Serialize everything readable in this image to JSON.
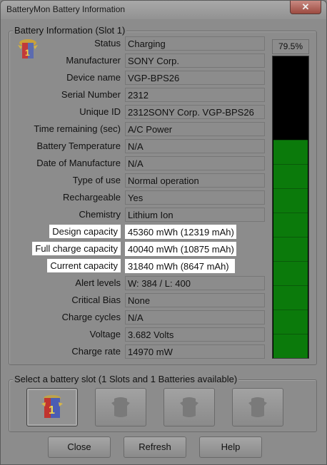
{
  "window": {
    "title": "BatteryMon Battery Information",
    "close_glyph": "✕"
  },
  "info_group": {
    "legend": "Battery Information (Slot 1)"
  },
  "fields": [
    {
      "label": "Status",
      "value": "Charging"
    },
    {
      "label": "Manufacturer",
      "value": "SONY Corp."
    },
    {
      "label": "Device name",
      "value": "VGP-BPS26"
    },
    {
      "label": "Serial Number",
      "value": "2312"
    },
    {
      "label": "Unique ID",
      "value": "2312SONY Corp. VGP-BPS26"
    },
    {
      "label": "Time remaining (sec)",
      "value": "A/C Power"
    },
    {
      "label": "Battery Temperature",
      "value": "N/A"
    },
    {
      "label": "Date of Manufacture",
      "value": "N/A"
    },
    {
      "label": "Type of use",
      "value": "Normal operation"
    },
    {
      "label": "Rechargeable",
      "value": "Yes"
    },
    {
      "label": "Chemistry",
      "value": "Lithium Ion"
    },
    {
      "label": "Design capacity",
      "value": "45360 mWh (12319 mAh)"
    },
    {
      "label": "Full charge capacity",
      "value": "40040 mWh (10875 mAh)"
    },
    {
      "label": "Current capacity",
      "value": "31840 mWh (8647 mAh)"
    },
    {
      "label": "Alert levels",
      "value": "W: 384 / L: 400"
    },
    {
      "label": "Critical Bias",
      "value": "None"
    },
    {
      "label": "Charge cycles",
      "value": "N/A"
    },
    {
      "label": "Voltage",
      "value": "3.682 Volts"
    },
    {
      "label": "Charge rate",
      "value": "14970 mW"
    }
  ],
  "charge_meter": {
    "percent_label": "79.5%",
    "level": 0.795,
    "fill_color": "#0b7a0b",
    "empty_color": "#000000"
  },
  "slot_group": {
    "legend": "Select a battery slot (1 Slots and 1 Batteries available)",
    "slots": [
      {
        "icon": "battery-slot-1-icon",
        "active": true,
        "number": "1"
      },
      {
        "icon": "battery-slot-empty-icon",
        "active": false
      },
      {
        "icon": "battery-slot-empty-icon",
        "active": false
      },
      {
        "icon": "battery-slot-empty-icon",
        "active": false
      }
    ]
  },
  "buttons": {
    "close": "Close",
    "refresh": "Refresh",
    "help": "Help"
  }
}
